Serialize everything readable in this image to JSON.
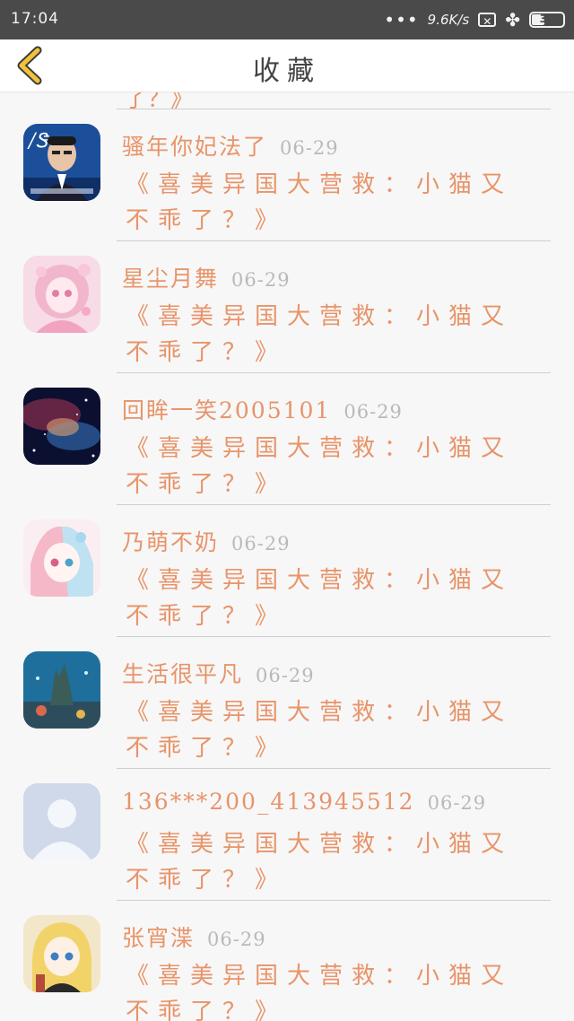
{
  "status_bar": {
    "time": "17:04",
    "dots": "•••",
    "speed": "9.6K/s",
    "box_icon_text": "✕",
    "battery": "38",
    "battery_level": 0.38
  },
  "nav": {
    "title": "收藏"
  },
  "partial_top_text": "了？》",
  "items": [
    {
      "name": "骚年你妃法了",
      "date": "06-29",
      "message": "《喜美异国大营救：小猫又不乖了？》"
    },
    {
      "name": "星尘月舞",
      "date": "06-29",
      "message": "《喜美异国大营救：小猫又不乖了？》"
    },
    {
      "name": "回眸一笑2005101",
      "date": "06-29",
      "message": "《喜美异国大营救：小猫又不乖了？》"
    },
    {
      "name": "乃萌不奶",
      "date": "06-29",
      "message": "《喜美异国大营救：小猫又不乖了？》"
    },
    {
      "name": "生活很平凡",
      "date": "06-29",
      "message": "《喜美异国大营救：小猫又不乖了？》"
    },
    {
      "name": "136***200_413945512",
      "date": "06-29",
      "message": "《喜美异国大营救：小猫又不乖了？》"
    },
    {
      "name": "张宵渫",
      "date": "06-29",
      "message": "《喜美异国大营救：小猫又不乖了？》"
    }
  ],
  "colors": {
    "accent": "#e8946a",
    "date": "#b9b9b9",
    "back_arrow": "#f2c23a"
  }
}
